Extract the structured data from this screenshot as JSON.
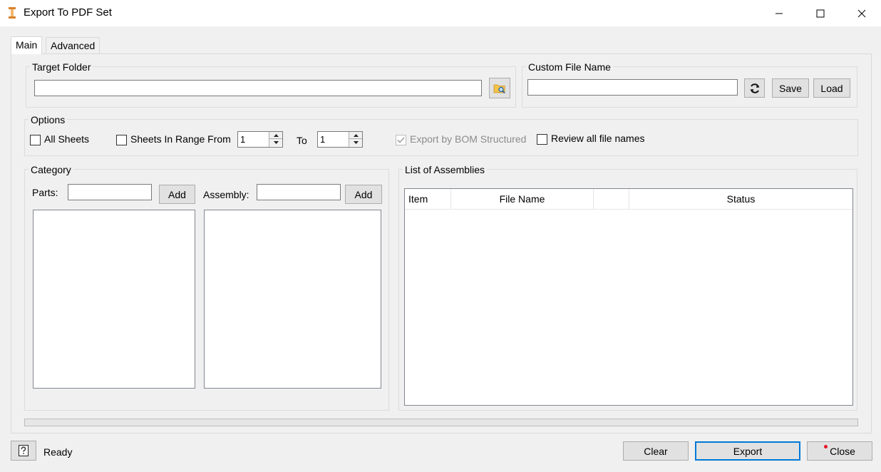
{
  "window": {
    "title": "Export To PDF Set",
    "controls": {
      "minimize": "–",
      "maximize": "☐",
      "close": "✕"
    }
  },
  "tabs": [
    {
      "label": "Main",
      "active": true
    },
    {
      "label": "Advanced",
      "active": false
    }
  ],
  "target_folder": {
    "title": "Target Folder",
    "value": "",
    "browse_icon": "folder-search-icon"
  },
  "custom_file_name": {
    "title": "Custom File Name",
    "value": "",
    "refresh_icon": "refresh-icon",
    "save_label": "Save",
    "load_label": "Load"
  },
  "options": {
    "title": "Options",
    "all_sheets": {
      "label": "All Sheets",
      "checked": false
    },
    "sheets_in_range": {
      "label": "Sheets In Range From",
      "checked": false
    },
    "from_value": "1",
    "to_label": "To",
    "to_value": "1",
    "export_by_bom": {
      "label": "Export by BOM Structured",
      "checked": true,
      "disabled": true
    },
    "review_all": {
      "label": "Review all file names",
      "checked": false
    }
  },
  "category": {
    "title": "Category",
    "parts_label": "Parts:",
    "parts_value": "",
    "parts_add": "Add",
    "assembly_label": "Assembly:",
    "assembly_value": "",
    "assembly_add": "Add"
  },
  "assemblies": {
    "title": "List of Assemblies",
    "columns": [
      "Item",
      "File Name",
      "",
      "Status"
    ]
  },
  "progress": {
    "value": 0
  },
  "status": {
    "help_icon": "help-icon",
    "text": "Ready"
  },
  "footer": {
    "clear_label": "Clear",
    "export_label": "Export",
    "close_label": "Close"
  },
  "colors": {
    "accent": "#0078d7",
    "close_dot": "#e81123",
    "icon_orange": "#d9822b"
  }
}
